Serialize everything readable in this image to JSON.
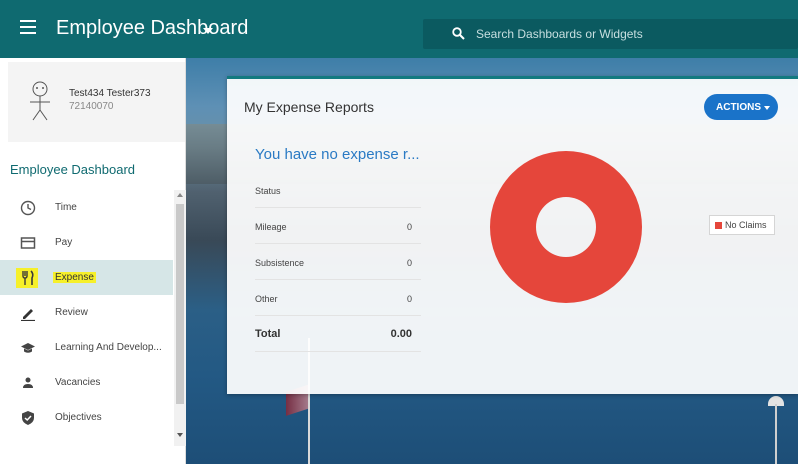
{
  "header": {
    "title": "Employee Dashboard",
    "search_placeholder": "Search Dashboards or Widgets"
  },
  "profile": {
    "name": "Test434 Tester373",
    "id": "72140070"
  },
  "sidebar": {
    "heading": "Employee Dashboard",
    "items": [
      {
        "label": "Time",
        "icon": "clock-icon"
      },
      {
        "label": "Pay",
        "icon": "wallet-icon"
      },
      {
        "label": "Expense",
        "icon": "fork-knife-icon",
        "active": true
      },
      {
        "label": "Review",
        "icon": "pencil-icon"
      },
      {
        "label": "Learning And Develop...",
        "icon": "graduation-cap-icon"
      },
      {
        "label": "Vacancies",
        "icon": "person-icon"
      },
      {
        "label": "Objectives",
        "icon": "shield-check-icon"
      }
    ]
  },
  "card": {
    "title": "My Expense Reports",
    "actions_label": "ACTIONS",
    "empty_message": "You have no expense r...",
    "status_header": "Status",
    "rows": [
      {
        "label": "Mileage",
        "value": "0"
      },
      {
        "label": "Subsistence",
        "value": "0"
      },
      {
        "label": "Other",
        "value": "0"
      }
    ],
    "total_label": "Total",
    "total_value": "0.00"
  },
  "chart_data": {
    "type": "pie",
    "categories": [
      "No Claims"
    ],
    "values": [
      1
    ],
    "colors": [
      "#e5463b"
    ],
    "legend": "right"
  },
  "colors": {
    "topbar": "#0f6a70",
    "accent_button": "#1a73c9",
    "highlight": "#f6f02a",
    "pie": "#e5463b"
  }
}
